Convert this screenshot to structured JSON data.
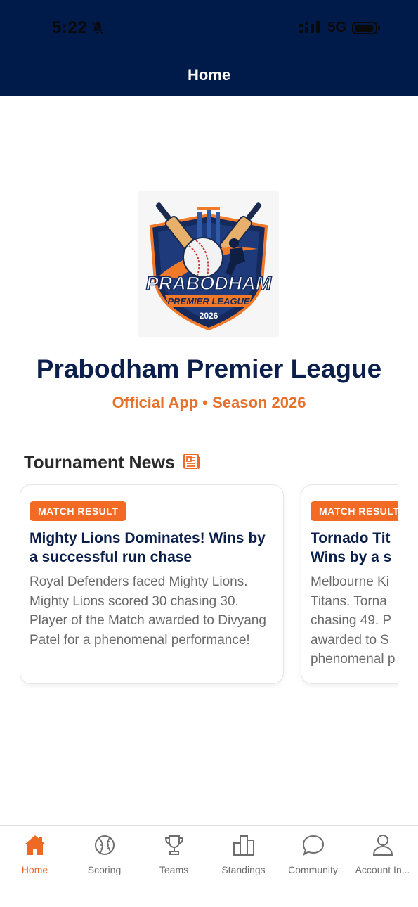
{
  "status_bar": {
    "time": "5:22",
    "network": "5G"
  },
  "header": {
    "title": "Home"
  },
  "app": {
    "title": "Prabodham Premier League",
    "subtitle": "Official App • Season 2026",
    "logo": {
      "line1": "PRABODHAM",
      "line2": "PREMIER LEAGUE",
      "year": "2026"
    }
  },
  "news": {
    "title": "Tournament News",
    "icon": "newspaper-icon",
    "cards": [
      {
        "badge": "MATCH RESULT",
        "title": "Mighty Lions Dominates! Wins by a successful run chase",
        "body": "Royal Defenders faced Mighty Lions. Mighty Lions scored 30 chasing 30. Player of the Match awarded to Divyang Patel for a phenomenal performance!"
      },
      {
        "badge": "MATCH RESULT",
        "title": "Tornado Tit Wins by a s",
        "body": "Melbourne Ki Titans. Torna chasing 49. P awarded to S phenomenal p"
      }
    ]
  },
  "tabs": [
    {
      "label": "Home",
      "icon": "home-icon",
      "active": true
    },
    {
      "label": "Scoring",
      "icon": "ball-icon",
      "active": false
    },
    {
      "label": "Teams",
      "icon": "trophy-icon",
      "active": false
    },
    {
      "label": "Standings",
      "icon": "podium-icon",
      "active": false
    },
    {
      "label": "Community",
      "icon": "chat-icon",
      "active": false
    },
    {
      "label": "Account In...",
      "icon": "user-icon",
      "active": false
    }
  ],
  "colors": {
    "navy": "#001a4a",
    "accent": "#f26a24",
    "inactive": "#6e6e6e"
  }
}
